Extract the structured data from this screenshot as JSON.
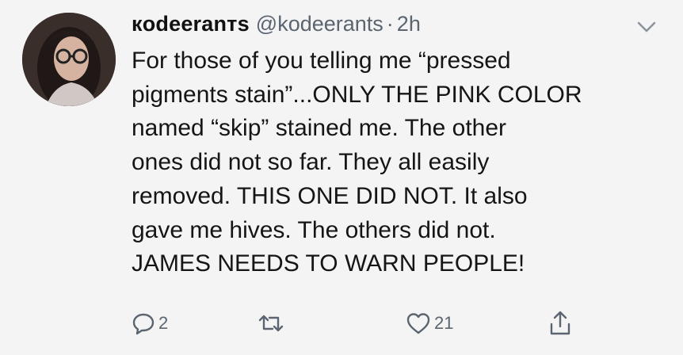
{
  "tweet": {
    "display_name": "кodeeranтs",
    "handle": "@kodeerants",
    "separator": "·",
    "time": "2h",
    "lines": [
      "For those of you telling me “pressed",
      "pigments stain”...ONLY THE PINK COLOR",
      "named “skip” stained me. The other",
      "ones did not so far. They all easily",
      "removed. THIS ONE DID NOT. It also",
      "gave me hives. The others did not.",
      "JAMES NEEDS TO WARN PEOPLE!"
    ],
    "actions": {
      "reply": {
        "icon": "reply-icon",
        "count": "2"
      },
      "retweet": {
        "icon": "retweet-icon",
        "count": ""
      },
      "like": {
        "icon": "heart-icon",
        "count": "21"
      },
      "share": {
        "icon": "share-icon",
        "count": ""
      }
    }
  },
  "colors": {
    "background": "#f4f4f4",
    "text": "#151515",
    "muted": "#5b6570"
  }
}
